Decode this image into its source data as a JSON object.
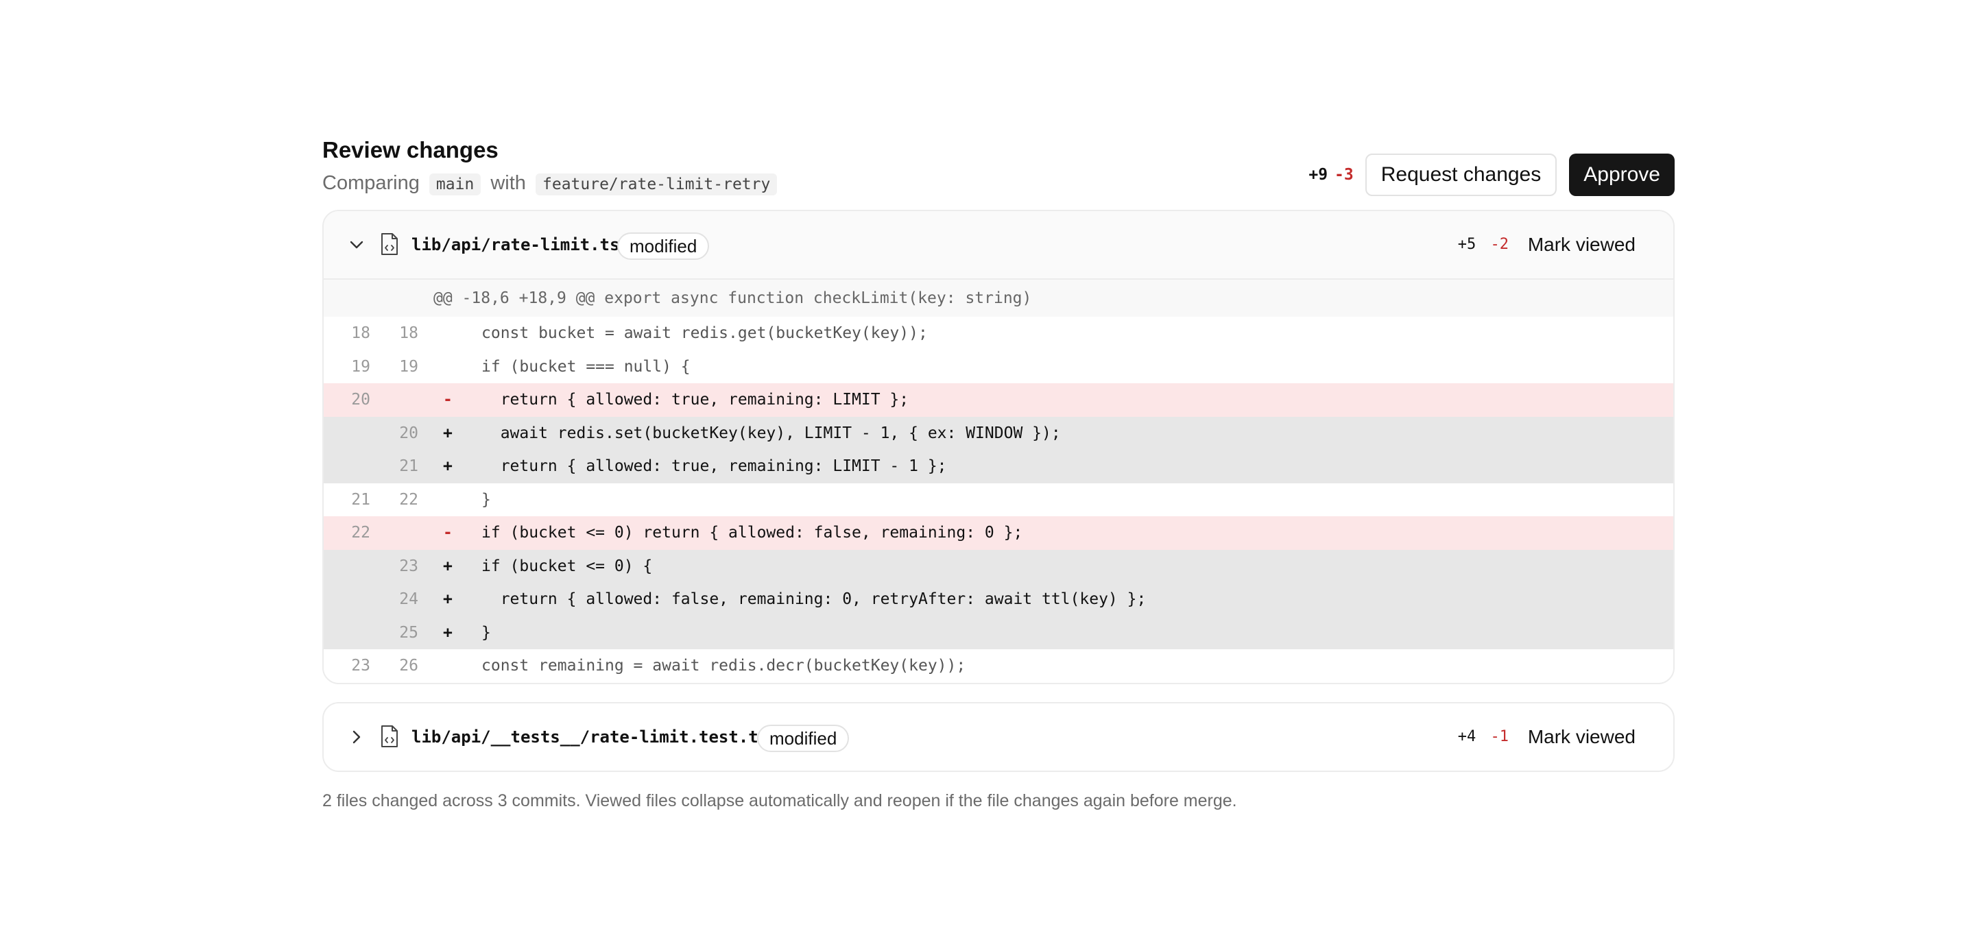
{
  "header": {
    "title": "Review changes",
    "compare_prefix": "Comparing",
    "base_branch": "main",
    "compare_with": "with",
    "head_branch": "feature/rate-limit-retry",
    "total_additions": "+9",
    "total_deletions": "-3",
    "request_changes_label": "Request changes",
    "approve_label": "Approve"
  },
  "files": [
    {
      "path": "lib/api/rate-limit.ts",
      "status": "modified",
      "additions": "+5",
      "deletions": "-2",
      "mark_viewed_label": "Mark viewed",
      "expanded": true,
      "hunk_header": "@@ -18,6 +18,9 @@ export async function checkLimit(key: string)",
      "lines": [
        {
          "type": "ctx",
          "old": "18",
          "new": "18",
          "sign": "",
          "code": "const bucket = await redis.get(bucketKey(key));"
        },
        {
          "type": "ctx",
          "old": "19",
          "new": "19",
          "sign": "",
          "code": "if (bucket === null) {"
        },
        {
          "type": "del",
          "old": "20",
          "new": "",
          "sign": "-",
          "code": "  return { allowed: true, remaining: LIMIT };"
        },
        {
          "type": "add",
          "old": "",
          "new": "20",
          "sign": "+",
          "code": "  await redis.set(bucketKey(key), LIMIT - 1, { ex: WINDOW });"
        },
        {
          "type": "add",
          "old": "",
          "new": "21",
          "sign": "+",
          "code": "  return { allowed: true, remaining: LIMIT - 1 };"
        },
        {
          "type": "ctx",
          "old": "21",
          "new": "22",
          "sign": "",
          "code": "}"
        },
        {
          "type": "del",
          "old": "22",
          "new": "",
          "sign": "-",
          "code": "if (bucket <= 0) return { allowed: false, remaining: 0 };"
        },
        {
          "type": "add",
          "old": "",
          "new": "23",
          "sign": "+",
          "code": "if (bucket <= 0) {"
        },
        {
          "type": "add",
          "old": "",
          "new": "24",
          "sign": "+",
          "code": "  return { allowed: false, remaining: 0, retryAfter: await ttl(key) };"
        },
        {
          "type": "add",
          "old": "",
          "new": "25",
          "sign": "+",
          "code": "}"
        },
        {
          "type": "ctx",
          "old": "23",
          "new": "26",
          "sign": "",
          "code": "const remaining = await redis.decr(bucketKey(key));"
        }
      ]
    },
    {
      "path": "lib/api/__tests__/rate-limit.test.ts",
      "status": "modified",
      "additions": "+4",
      "deletions": "-1",
      "mark_viewed_label": "Mark viewed",
      "expanded": false
    }
  ],
  "footer": {
    "note": "2 files changed across 3 commits. Viewed files collapse automatically and reopen if the file changes again before merge."
  },
  "colors": {
    "accent": "#161616",
    "deletion": "#c42b2b",
    "deleted_row_bg": "#fce6e7",
    "added_row_bg": "#e7e7e7"
  },
  "icons": {
    "expand": "chevron-down-icon",
    "collapse": "chevron-right-icon",
    "file": "code-file-icon"
  }
}
